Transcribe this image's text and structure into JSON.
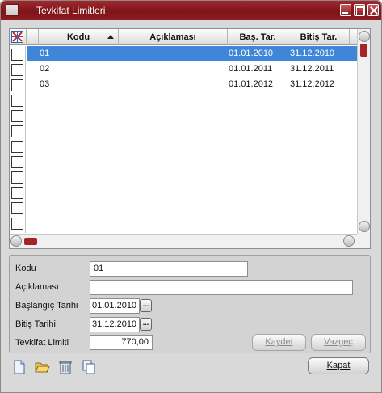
{
  "window": {
    "title": "Tevkifat Limitleri"
  },
  "grid": {
    "columns": {
      "code": "Kodu",
      "desc": "Açıklaması",
      "start": "Baş. Tar.",
      "end": "Bitiş Tar."
    },
    "rows": [
      {
        "code": "01",
        "desc": "",
        "start": "01.01.2010",
        "end": "31.12.2010",
        "selected": true
      },
      {
        "code": "02",
        "desc": "",
        "start": "01.01.2011",
        "end": "31.12.2011",
        "selected": false
      },
      {
        "code": "03",
        "desc": "",
        "start": "01.01.2012",
        "end": "31.12.2012",
        "selected": false
      }
    ]
  },
  "form": {
    "code_label": "Kodu",
    "code_value": "01",
    "desc_label": "Açıklaması",
    "desc_value": "",
    "start_label": "Başlangıç Tarihi",
    "start_value": "01.01.2010",
    "end_label": "Bitiş Tarihi",
    "end_value": "31.12.2010",
    "limit_label": "Tevkifat Limiti",
    "limit_value": "770,00",
    "lookup_label": "..."
  },
  "buttons": {
    "save": "Kaydet",
    "cancel": "Vazgeç",
    "close": "Kapat"
  },
  "colors": {
    "titlebar": "#8d1d22",
    "selection": "#3f86d9",
    "accent": "#a7232a"
  }
}
